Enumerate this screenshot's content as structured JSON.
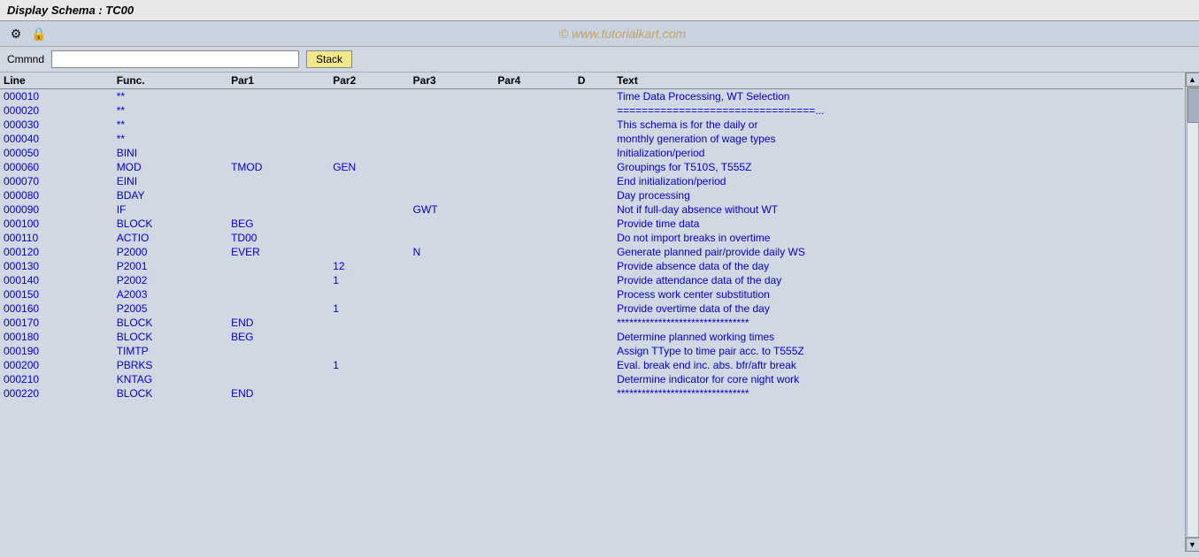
{
  "title": "Display Schema : TC00",
  "watermark": "© www.tutorialkart.com",
  "toolbar": {
    "icons": [
      {
        "name": "settings-icon",
        "symbol": "⚙"
      },
      {
        "name": "lock-icon",
        "symbol": "🔒"
      }
    ]
  },
  "command_bar": {
    "label": "Cmmnd",
    "placeholder": "",
    "stack_button": "Stack"
  },
  "table": {
    "headers": [
      "Line",
      "Func.",
      "Par1",
      "Par2",
      "Par3",
      "Par4",
      "D",
      "Text"
    ],
    "rows": [
      {
        "line": "000010",
        "func": "**",
        "par1": "",
        "par2": "",
        "par3": "",
        "par4": "",
        "d": "",
        "text": "Time Data Processing, WT Selection"
      },
      {
        "line": "000020",
        "func": "**",
        "par1": "",
        "par2": "",
        "par3": "",
        "par4": "",
        "d": "",
        "text": "================================..."
      },
      {
        "line": "000030",
        "func": "**",
        "par1": "",
        "par2": "",
        "par3": "",
        "par4": "",
        "d": "",
        "text": "This schema is for the daily or"
      },
      {
        "line": "000040",
        "func": "**",
        "par1": "",
        "par2": "",
        "par3": "",
        "par4": "",
        "d": "",
        "text": "monthly generation of wage types"
      },
      {
        "line": "000050",
        "func": "BINI",
        "par1": "",
        "par2": "",
        "par3": "",
        "par4": "",
        "d": "",
        "text": "Initialization/period"
      },
      {
        "line": "000060",
        "func": "MOD",
        "par1": "TMOD",
        "par2": "GEN",
        "par3": "",
        "par4": "",
        "d": "",
        "text": "Groupings for T510S, T555Z"
      },
      {
        "line": "000070",
        "func": "EINI",
        "par1": "",
        "par2": "",
        "par3": "",
        "par4": "",
        "d": "",
        "text": "End initialization/period"
      },
      {
        "line": "000080",
        "func": "BDAY",
        "par1": "",
        "par2": "",
        "par3": "",
        "par4": "",
        "d": "",
        "text": "Day processing"
      },
      {
        "line": "000090",
        "func": "IF",
        "par1": "",
        "par2": "",
        "par3": "GWT",
        "par4": "",
        "d": "",
        "text": "Not if full-day absence without WT"
      },
      {
        "line": "000100",
        "func": "BLOCK",
        "par1": "BEG",
        "par2": "",
        "par3": "",
        "par4": "",
        "d": "",
        "text": "Provide time data"
      },
      {
        "line": "000110",
        "func": "ACTIO",
        "par1": "TD00",
        "par2": "",
        "par3": "",
        "par4": "",
        "d": "",
        "text": "Do not import breaks in overtime"
      },
      {
        "line": "000120",
        "func": "P2000",
        "par1": "EVER",
        "par2": "",
        "par3": "N",
        "par4": "",
        "d": "",
        "text": "Generate planned pair/provide daily WS"
      },
      {
        "line": "000130",
        "func": "P2001",
        "par1": "",
        "par2": "12",
        "par3": "",
        "par4": "",
        "d": "",
        "text": "Provide absence data of the day"
      },
      {
        "line": "000140",
        "func": "P2002",
        "par1": "",
        "par2": "1",
        "par3": "",
        "par4": "",
        "d": "",
        "text": "Provide attendance data of the day"
      },
      {
        "line": "000150",
        "func": "A2003",
        "par1": "",
        "par2": "",
        "par3": "",
        "par4": "",
        "d": "",
        "text": "Process work center substitution"
      },
      {
        "line": "000160",
        "func": "P2005",
        "par1": "",
        "par2": "1",
        "par3": "",
        "par4": "",
        "d": "",
        "text": "Provide overtime data of the day"
      },
      {
        "line": "000170",
        "func": "BLOCK",
        "par1": "END",
        "par2": "",
        "par3": "",
        "par4": "",
        "d": "",
        "text": "********************************"
      },
      {
        "line": "000180",
        "func": "BLOCK",
        "par1": "BEG",
        "par2": "",
        "par3": "",
        "par4": "",
        "d": "",
        "text": "Determine planned working times"
      },
      {
        "line": "000190",
        "func": "TIMTP",
        "par1": "",
        "par2": "",
        "par3": "",
        "par4": "",
        "d": "",
        "text": "Assign TType to time pair acc. to T555Z"
      },
      {
        "line": "000200",
        "func": "PBRKS",
        "par1": "",
        "par2": "1",
        "par3": "",
        "par4": "",
        "d": "",
        "text": "Eval. break end inc. abs. bfr/aftr break"
      },
      {
        "line": "000210",
        "func": "KNTAG",
        "par1": "",
        "par2": "",
        "par3": "",
        "par4": "",
        "d": "",
        "text": "Determine indicator for core night work"
      },
      {
        "line": "000220",
        "func": "BLOCK",
        "par1": "END",
        "par2": "",
        "par3": "",
        "par4": "",
        "d": "",
        "text": "********************************"
      }
    ]
  }
}
